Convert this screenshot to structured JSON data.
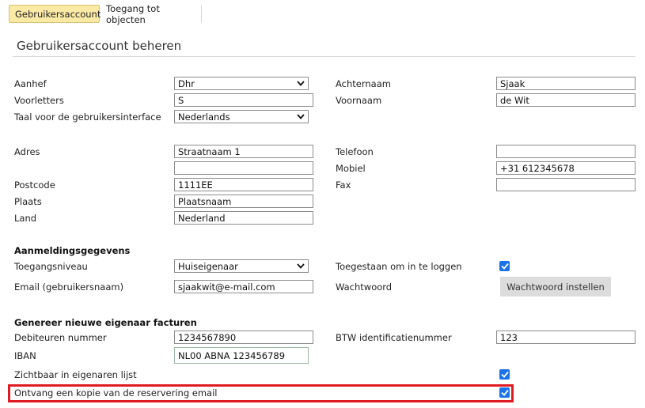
{
  "tabs": [
    {
      "label": "Gebruikersaccount",
      "active": true
    },
    {
      "label": "Toegang tot objecten",
      "active": false
    }
  ],
  "page_title": "Gebruikersaccount beheren",
  "personal": {
    "aanhef_label": "Aanhef",
    "aanhef_value": "Dhr",
    "voorletters_label": "Voorletters",
    "voorletters_value": "S",
    "taal_label": "Taal voor de gebruikersinterface",
    "taal_value": "Nederlands",
    "achternaam_label": "Achternaam",
    "achternaam_value": "Sjaak",
    "voornaam_label": "Voornaam",
    "voornaam_value": "de Wit"
  },
  "address": {
    "adres_label": "Adres",
    "adres_value": "Straatnaam 1",
    "adres2_value": "",
    "postcode_label": "Postcode",
    "postcode_value": "1111EE",
    "plaats_label": "Plaats",
    "plaats_value": "Plaatsnaam",
    "land_label": "Land",
    "land_value": "Nederland",
    "telefoon_label": "Telefoon",
    "telefoon_value": "",
    "mobiel_label": "Mobiel",
    "mobiel_value": "+31 612345678",
    "fax_label": "Fax",
    "fax_value": ""
  },
  "login": {
    "section_title": "Aanmeldingsgegevens",
    "toegangsniveau_label": "Toegangsniveau",
    "toegangsniveau_value": "Huiseigenaar",
    "email_label": "Email (gebruikersnaam)",
    "email_value": "sjaakwit@e-mail.com",
    "allowed_label": "Toegestaan om in te loggen",
    "allowed_checked": true,
    "wachtwoord_label": "Wachtwoord",
    "wachtwoord_button": "Wachtwoord instellen"
  },
  "invoices": {
    "section_title": "Genereer nieuwe eigenaar facturen",
    "debiteuren_label": "Debiteuren nummer",
    "debiteuren_value": "1234567890",
    "btw_label": "BTW identificatienummer",
    "btw_value": "123",
    "iban_label": "IBAN",
    "iban_value": "NL00 ABNA 123456789",
    "zichtbaar_label": "Zichtbaar in eigenaren lijst",
    "zichtbaar_checked": true,
    "kopie_label": "Ontvang een kopie van de reservering email",
    "kopie_checked": true
  },
  "colors": {
    "tab_active_bg": "#fbe9a6",
    "checkbox": "#1a73e8",
    "highlight_border": "#e01a22",
    "button_bg": "#dcdcdc"
  }
}
